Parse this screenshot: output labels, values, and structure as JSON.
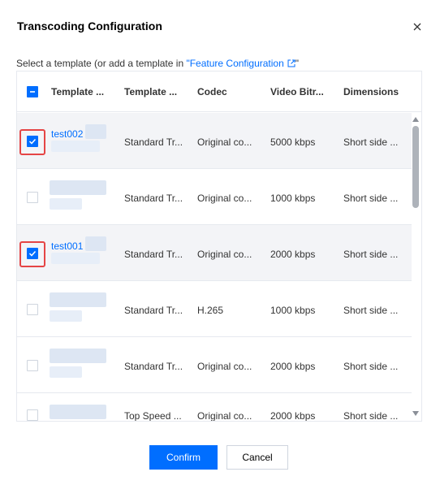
{
  "dialog": {
    "title": "Transcoding Configuration",
    "prompt_prefix": "Select a template (or add a template in ",
    "prompt_link": "\"Feature Configuration",
    "prompt_suffix": "\""
  },
  "table": {
    "columns": [
      "Template ...",
      "Template ...",
      "Codec",
      "Video Bitr...",
      "Dimensions"
    ],
    "rows": [
      {
        "checked": true,
        "name": "test002",
        "type": "Standard Tr...",
        "codec": "Original co...",
        "bitrate": "5000 kbps",
        "dimensions": "Short side ..."
      },
      {
        "checked": false,
        "name": "",
        "type": "Standard Tr...",
        "codec": "Original co...",
        "bitrate": "1000 kbps",
        "dimensions": "Short side ..."
      },
      {
        "checked": true,
        "name": "test001",
        "type": "Standard Tr...",
        "codec": "Original co...",
        "bitrate": "2000 kbps",
        "dimensions": "Short side ..."
      },
      {
        "checked": false,
        "name": "",
        "type": "Standard Tr...",
        "codec": "H.265",
        "bitrate": "1000 kbps",
        "dimensions": "Short side ..."
      },
      {
        "checked": false,
        "name": "",
        "type": "Standard Tr...",
        "codec": "Original co...",
        "bitrate": "2000 kbps",
        "dimensions": "Short side ..."
      },
      {
        "checked": false,
        "name": "",
        "type": "Top Speed ...",
        "codec": "Original co...",
        "bitrate": "2000 kbps",
        "dimensions": "Short side ..."
      }
    ]
  },
  "footer": {
    "confirm_label": "Confirm",
    "cancel_label": "Cancel"
  },
  "colors": {
    "accent": "#006eff",
    "highlight": "#e54545",
    "selected_row": "#f3f4f7"
  }
}
